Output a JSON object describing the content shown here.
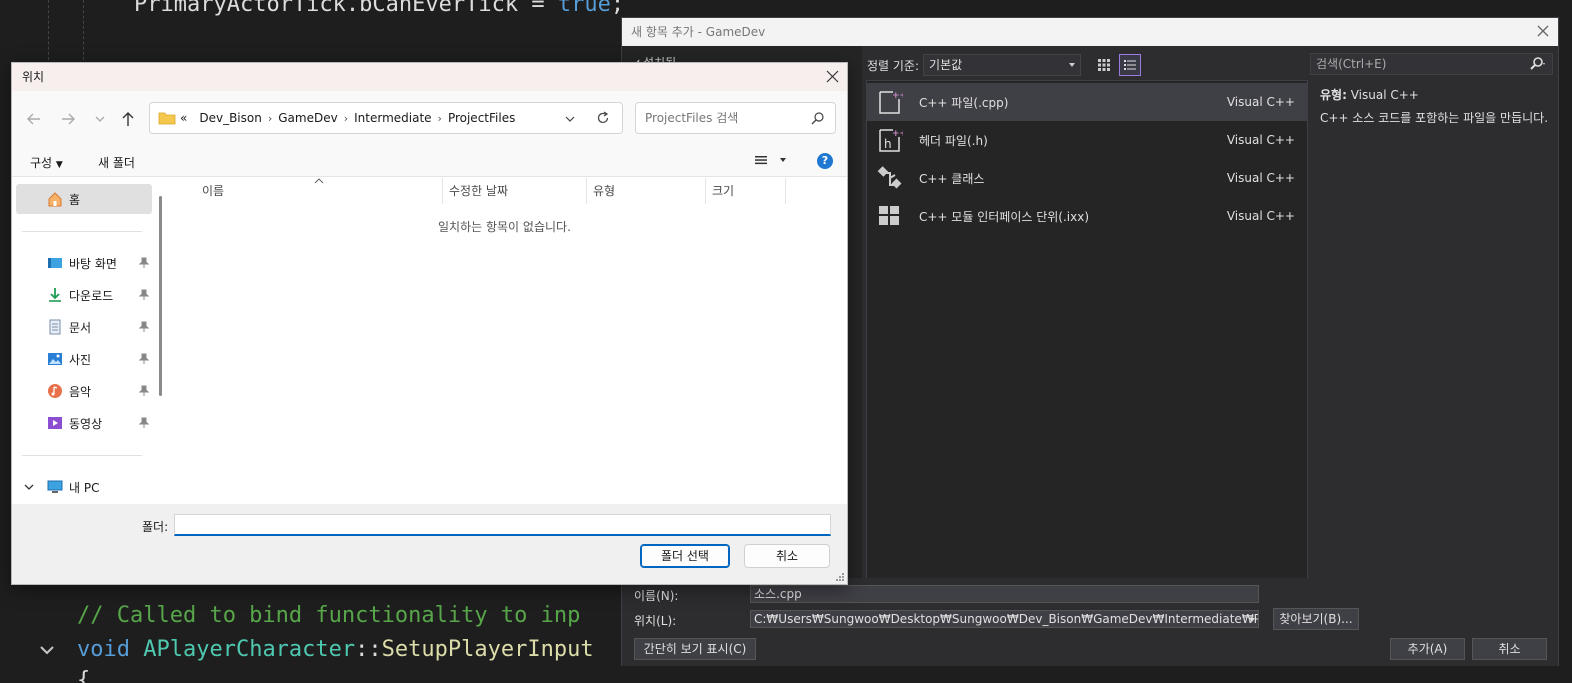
{
  "editor": {
    "line_top": {
      "ident": "PrimaryActorTick.bCanEverTick = ",
      "kw": "true",
      "punct": ";"
    },
    "comment": "// Called to bind functionality to inp",
    "sig_kw": "void",
    "sig_type": "APlayerCharacter",
    "sig_sep": "::",
    "sig_fn": "SetupPlayerInput",
    "brace": "{"
  },
  "vs_dialog": {
    "title": "새 항목 추가 - GameDev",
    "installed_label": "◢ 설치됨",
    "sort_label": "정렬 기준:",
    "sort_value": "기본값",
    "search_placeholder": "검색(Ctrl+E)",
    "items": [
      {
        "name": "C++ 파일(.cpp)",
        "type": "Visual C++",
        "icon": "cpp-file-icon"
      },
      {
        "name": "헤더 파일(.h)",
        "type": "Visual C++",
        "icon": "header-file-icon"
      },
      {
        "name": "C++ 클래스",
        "type": "Visual C++",
        "icon": "cpp-class-icon"
      },
      {
        "name": "C++ 모듈 인터페이스 단위(.ixx)",
        "type": "Visual C++",
        "icon": "module-interface-icon"
      }
    ],
    "info": {
      "type_label": "유형:",
      "type_value": "Visual C++",
      "description": "C++ 소스 코드를 포함하는 파일을 만듭니다."
    },
    "name_label": "이름(N):",
    "name_value": "소스.cpp",
    "location_label": "위치(L):",
    "location_value": "C:₩Users₩Sungwoo₩Desktop₩Sungwoo₩Dev_Bison₩GameDev₩Intermediate₩ProjectFiles",
    "browse_button": "찾아보기(B)...",
    "compact_button": "간단히 보기 표시(C)",
    "add_button": "추가(A)",
    "cancel_button": "취소"
  },
  "folder_dialog": {
    "title": "위치",
    "breadcrumb": [
      "Dev_Bison",
      "GameDev",
      "Intermediate",
      "ProjectFiles"
    ],
    "breadcrumb_overflow": "«",
    "search_placeholder": "ProjectFiles 검색",
    "organize_label": "구성",
    "new_folder_label": "새 폴더",
    "sidebar": [
      {
        "label": "홈",
        "icon": "home-icon"
      },
      {
        "label": "바탕 화면",
        "icon": "desktop-icon"
      },
      {
        "label": "다운로드",
        "icon": "download-icon"
      },
      {
        "label": "문서",
        "icon": "documents-icon"
      },
      {
        "label": "사진",
        "icon": "pictures-icon"
      },
      {
        "label": "음악",
        "icon": "music-icon"
      },
      {
        "label": "동영상",
        "icon": "videos-icon"
      },
      {
        "label": "내 PC",
        "icon": "pc-icon"
      }
    ],
    "columns": [
      "이름",
      "수정한 날짜",
      "유형",
      "크기"
    ],
    "empty_message": "일치하는 항목이 없습니다.",
    "folder_label": "폴더:",
    "folder_value": "",
    "select_button": "폴더 선택",
    "cancel_button": "취소",
    "help_glyph": "?"
  },
  "colors": {
    "editor_bg": "#1e1e1e",
    "vs_accent": "#9c7ce0",
    "win_accent": "#0067c0"
  }
}
